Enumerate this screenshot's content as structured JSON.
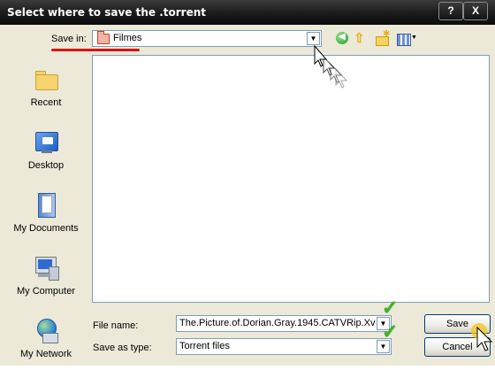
{
  "window": {
    "title": "Select where to save the .torrent",
    "help_button": "?",
    "close_button": "X"
  },
  "toolbar": {
    "save_in_label": "Save in:",
    "save_in_value": "Filmes",
    "icons": [
      "back-icon",
      "up-folder-icon",
      "new-folder-icon",
      "view-menu-icon"
    ]
  },
  "places": [
    {
      "label": "Recent",
      "icon": "recent-folder-icon"
    },
    {
      "label": "Desktop",
      "icon": "desktop-icon"
    },
    {
      "label": "My Documents",
      "icon": "my-documents-icon"
    },
    {
      "label": "My Computer",
      "icon": "my-computer-icon"
    },
    {
      "label": "My Network",
      "icon": "my-network-icon"
    }
  ],
  "form": {
    "file_name_label": "File name:",
    "file_name_value": "The.Picture.of.Dorian.Gray.1945.CATVRip.Xvi",
    "save_as_type_label": "Save as type:",
    "save_as_type_value": "Torrent files"
  },
  "buttons": {
    "save": "Save",
    "cancel": "Cancel"
  },
  "colors": {
    "title_bar": "#1a1a1a",
    "dialog_bg": "#ece9d8",
    "highlight_underline": "#e01010",
    "checkmark": "#3fb424",
    "field_border": "#7f9db9"
  }
}
